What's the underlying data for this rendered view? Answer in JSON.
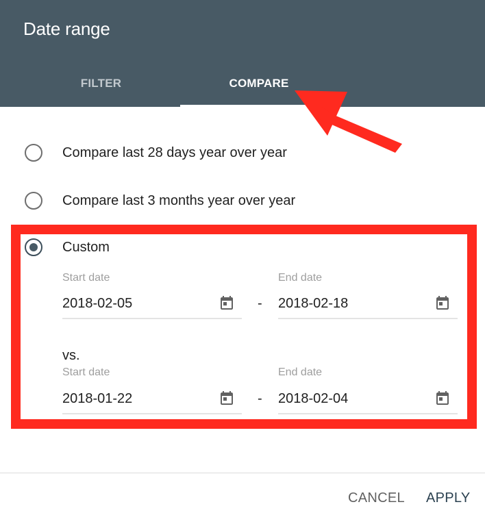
{
  "dialog": {
    "title": "Date range",
    "tabs": [
      {
        "label": "FILTER",
        "active": false
      },
      {
        "label": "COMPARE",
        "active": true
      }
    ]
  },
  "options": [
    {
      "label": "Compare last 28 days year over year",
      "selected": false
    },
    {
      "label": "Compare last 3 months year over year",
      "selected": false
    },
    {
      "label": "Custom",
      "selected": true
    }
  ],
  "custom": {
    "range1": {
      "start_label": "Start date",
      "start_value": "2018-02-05",
      "separator": "-",
      "end_label": "End date",
      "end_value": "2018-02-18"
    },
    "vs_label": "vs.",
    "range2": {
      "start_label": "Start date",
      "start_value": "2018-01-22",
      "separator": "-",
      "end_label": "End date",
      "end_value": "2018-02-04"
    }
  },
  "footer": {
    "cancel_label": "CANCEL",
    "apply_label": "APPLY"
  },
  "annotations": {
    "highlight_color": "#ff2a1f"
  },
  "icons": {
    "calendar": "calendar-icon"
  },
  "colors": {
    "header_bg": "#485a65",
    "accent": "#2b4150"
  }
}
